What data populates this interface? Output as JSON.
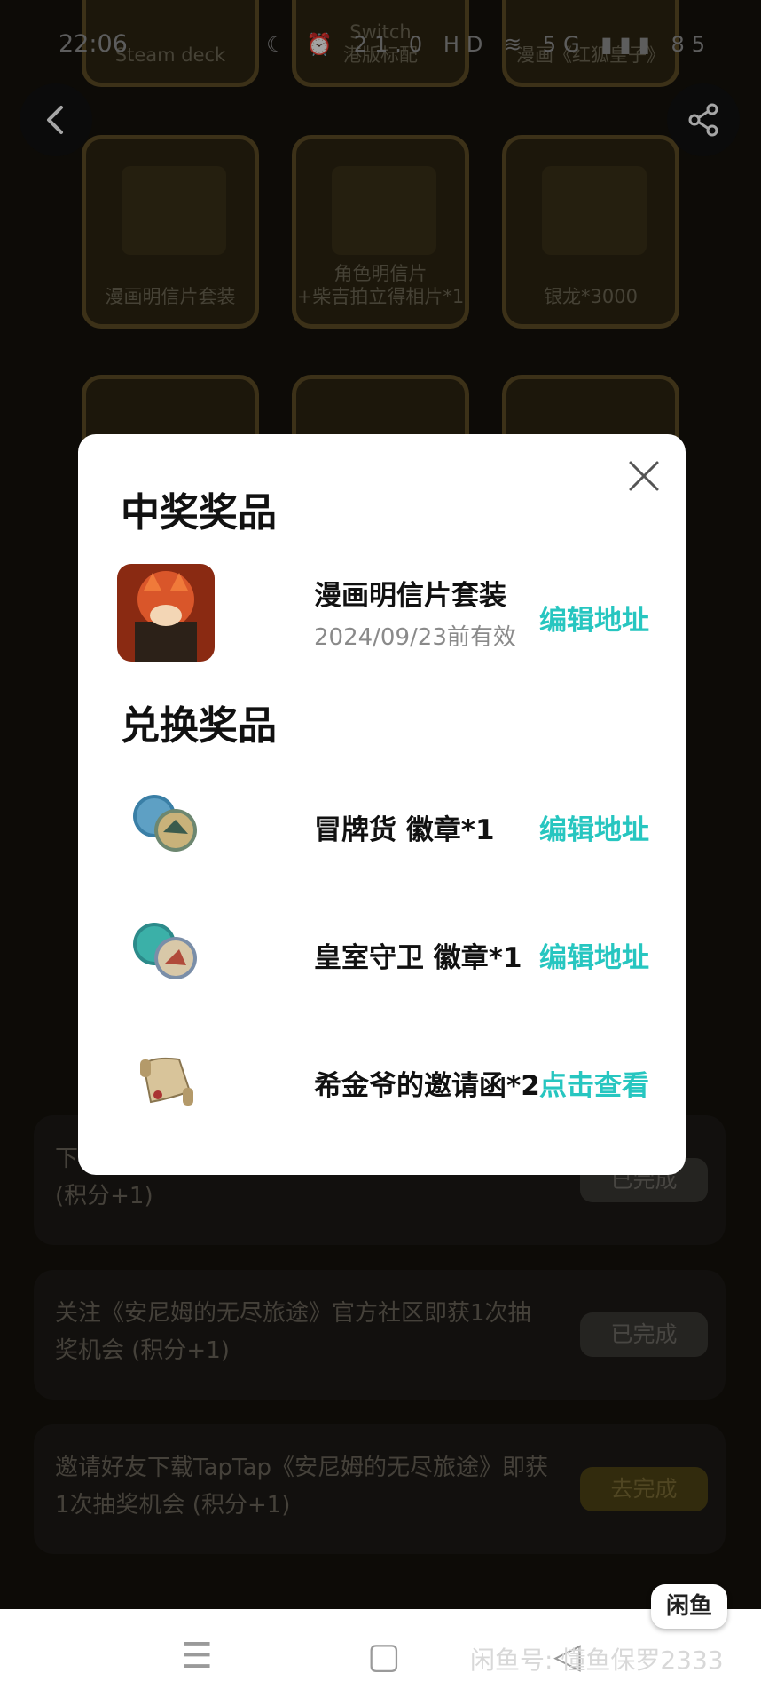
{
  "status_bar": {
    "time": "22:06",
    "icons": "☾ ⏰ 21.0 HD ≋ 5G ▮▮▮ 85"
  },
  "background": {
    "top_labels": [
      "Steam deck",
      "Switch\n港版标配",
      "漫画《红狐皇子》"
    ],
    "grid_labels": [
      "漫画明信片套装",
      "角色明信片\n+柴吉拍立得相片*1",
      "银龙*3000"
    ],
    "tasks": [
      {
        "text": "下\n(积分+1)",
        "button": "已完成"
      },
      {
        "text": "关注《安尼姆的无尽旅途》官方社区即获1次抽奖机会 (积分+1)",
        "button": "已完成"
      },
      {
        "text": "邀请好友下载TapTap《安尼姆的无尽旅途》即获1次抽奖机会 (积分+1)",
        "button": "去完成"
      }
    ]
  },
  "modal": {
    "won_title": "中奖奖品",
    "won_item": {
      "name": "漫画明信片套装",
      "validity": "2024/09/23前有效",
      "action": "编辑地址"
    },
    "exchange_title": "兑换奖品",
    "exchange_items": [
      {
        "name": "冒牌货 徽章*1",
        "action": "编辑地址"
      },
      {
        "name": "皇室守卫 徽章*1",
        "action": "编辑地址"
      },
      {
        "name": "希金爷的邀请函*2",
        "action": "点击查看"
      }
    ]
  },
  "floating_badge": "闲鱼",
  "watermark": "闲鱼号: 懂鱼保罗2333",
  "colors": {
    "accent": "#27c6c0",
    "modal_bg": "#ffffff",
    "card_border": "#5d4c25"
  }
}
